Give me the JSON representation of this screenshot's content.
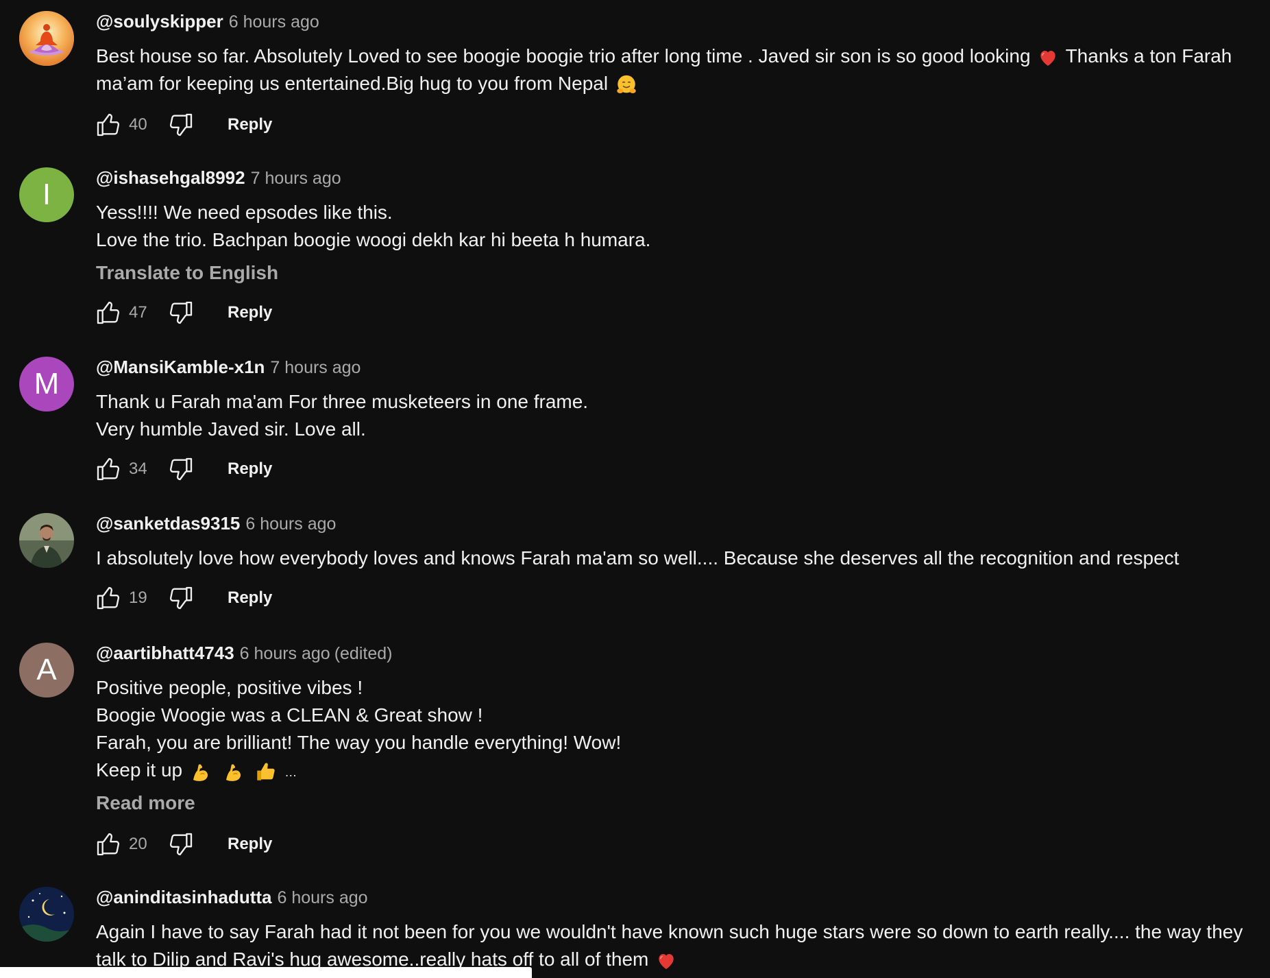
{
  "colors": {
    "background": "#0f0f0f",
    "text_primary": "#f1f1f1",
    "text_secondary": "#aaaaaa",
    "avatar_I": "#7cb342",
    "avatar_M": "#ab47bc",
    "avatar_A": "#8d6e63"
  },
  "actions": {
    "reply_label": "Reply",
    "translate_label": "Translate to English",
    "read_more_label": "Read more"
  },
  "comments": [
    {
      "author": "@soulyskipper",
      "time": "6 hours ago",
      "avatar_icon": "meditation-lotus-icon",
      "lines": [
        "Best house so far. Absolutely Loved to see boogie boogie trio  after long time . Javed sir son is so good looking",
        "Thanks a ton Farah",
        "ma’am for keeping us entertained.Big hug to you from Nepal"
      ],
      "emoji": [
        "red-heart-icon",
        "hugging-face-icon"
      ],
      "likes": "40"
    },
    {
      "author": "@ishasehgal8992",
      "time": "7 hours ago",
      "avatar_letter": "I",
      "lines": [
        "Yess!!!! We need epsodes like this.",
        "Love the trio. Bachpan boogie woogi dekh kar hi beeta h humara."
      ],
      "likes": "47"
    },
    {
      "author": "@MansiKamble-x1n",
      "time": "7 hours ago",
      "avatar_letter": "M",
      "lines": [
        "Thank u Farah ma'am For three musketeers in one frame.",
        "Very humble Javed sir. Love all."
      ],
      "likes": "34"
    },
    {
      "author": "@sanketdas9315",
      "time": "6 hours ago",
      "avatar_icon": "person-photo-icon",
      "lines": [
        "I absolutely love how everybody loves and knows Farah ma'am so well.... Because she deserves all the recognition and respect"
      ],
      "likes": "19"
    },
    {
      "author": "@aartibhatt4743",
      "time": "6 hours ago",
      "edited": "(edited)",
      "avatar_letter": "A",
      "lines": [
        "Positive people, positive vibes !",
        "Boogie Woogie was a CLEAN & Great show !",
        "Farah, you are brilliant! The way you handle everything! Wow!",
        "Keep it up",
        "…"
      ],
      "emoji": [
        "flexed-biceps-icon",
        "flexed-biceps-icon",
        "thumbs-up-icon"
      ],
      "likes": "20"
    },
    {
      "author": "@aninditasinhadutta",
      "time": "6 hours ago",
      "avatar_icon": "night-sky-moon-icon",
      "lines": [
        "Again I have to say Farah had it not been for you we wouldn't  have known such huge stars were so down to earth really.... the way they",
        "talk to Dilip and  Ravi's hug awesome..really hats off to all of them"
      ],
      "emoji": [
        "red-heart-icon"
      ]
    }
  ]
}
